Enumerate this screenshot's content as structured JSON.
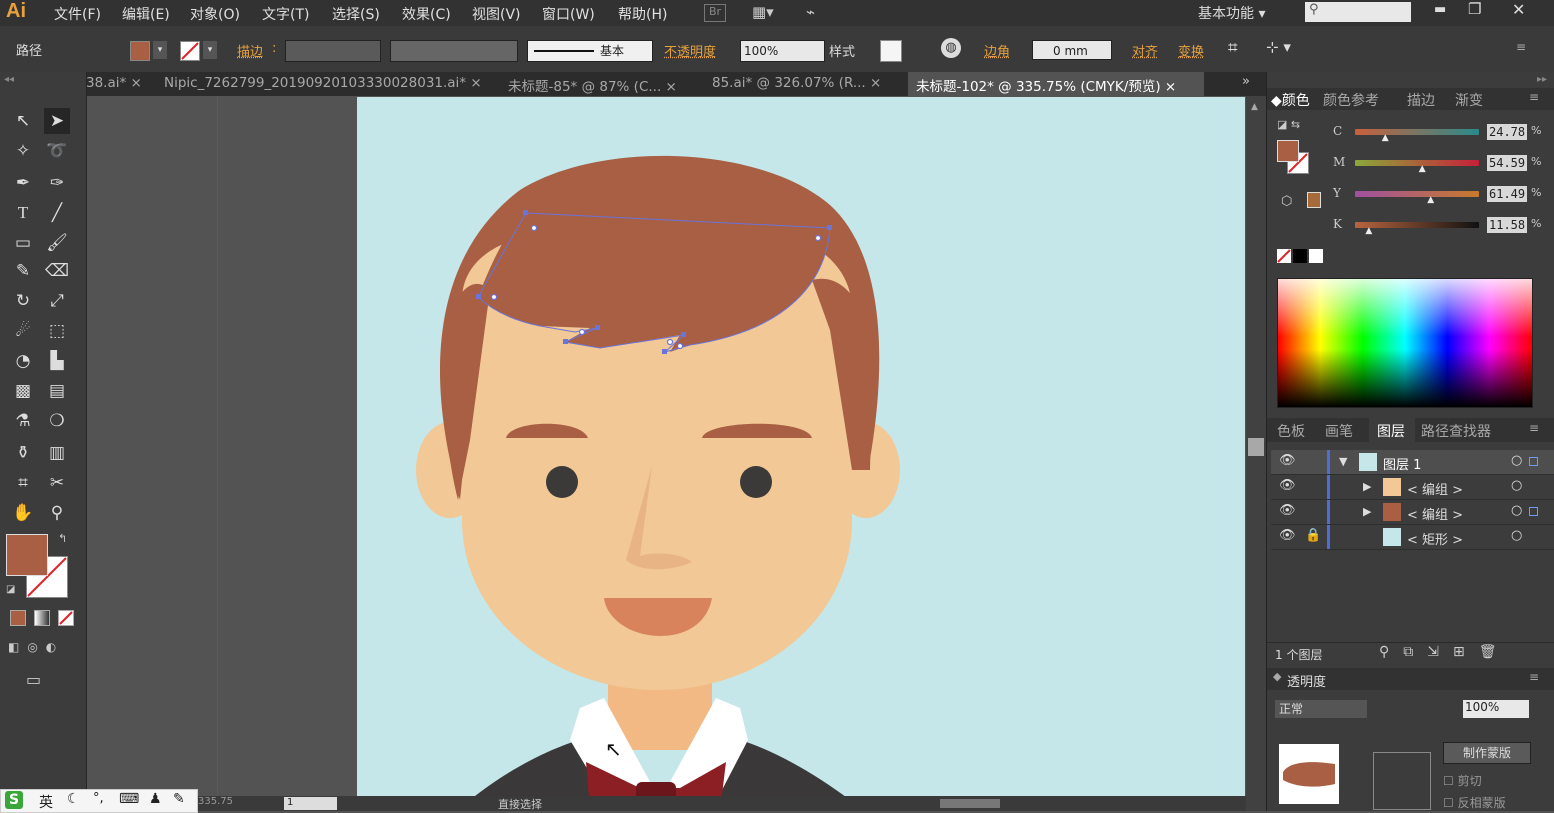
{
  "app": {
    "logo": "Ai"
  },
  "menu": [
    "文件(F)",
    "编辑(E)",
    "对象(O)",
    "文字(T)",
    "选择(S)",
    "效果(C)",
    "视图(V)",
    "窗口(W)",
    "帮助(H)"
  ],
  "menu_right": {
    "workspace": "基本功能",
    "bridge": "Br"
  },
  "control": {
    "object_type": "路径",
    "stroke_label": "描边",
    "stroke_style": "基本",
    "opacity_label": "不透明度",
    "opacity_value": "100%",
    "style_label": "样式",
    "corner_label": "边角",
    "corner_value": "0 mm",
    "align_label": "对齐",
    "transform_label": "变换"
  },
  "tabs": [
    {
      "label": "38.ai* ×"
    },
    {
      "label": "Nipic_7262799_20190920103330028031.ai* ×"
    },
    {
      "label": "未标题-85* @ 87% (C...  ×"
    },
    {
      "label": "85.ai* @ 326.07% (R...  ×"
    },
    {
      "label": "未标题-102* @ 335.75% (CMYK/预览)  ×"
    }
  ],
  "color_panel": {
    "tabs": [
      "颜色",
      "颜色参考",
      "描边",
      "渐变"
    ],
    "channels": [
      {
        "name": "C",
        "value": "24.78",
        "unit": "%",
        "level": 0.248
      },
      {
        "name": "M",
        "value": "54.59",
        "unit": "%",
        "level": 0.546
      },
      {
        "name": "Y",
        "value": "61.49",
        "unit": "%",
        "level": 0.615
      },
      {
        "name": "K",
        "value": "11.58",
        "unit": "%",
        "level": 0.116
      }
    ],
    "fill_color": "#a85f43"
  },
  "layers_panel": {
    "tabs": [
      "色板",
      "画笔",
      "图层",
      "路径查找器"
    ],
    "rows": [
      {
        "name": "图层  1",
        "indent": 0
      },
      {
        "name": "< 编组 >",
        "indent": 1
      },
      {
        "name": "< 编组 >",
        "indent": 1
      },
      {
        "name": "< 矩形 >",
        "indent": 1
      }
    ],
    "footer": "1 个图层"
  },
  "transparency_panel": {
    "title": "透明度",
    "mode": "正常",
    "opacity": "100%",
    "make_mask": "制作蒙版",
    "clip": "剪切",
    "invert": "反相蒙版"
  },
  "status": {
    "zoom": "335.75",
    "page": "1",
    "tool": "直接选择"
  },
  "ime": {
    "lang": "英"
  },
  "colors": {
    "hair": "#a85f43",
    "skin": "#f2c896",
    "skin_shadow": "#e8b485",
    "eye": "#3c3939",
    "mouth": "#d9835d",
    "bg": "#c5e7ea",
    "collar": "#ffffff",
    "vest": "#3a3838",
    "tie": "#8b1f24",
    "accent": "#e8a13c"
  }
}
